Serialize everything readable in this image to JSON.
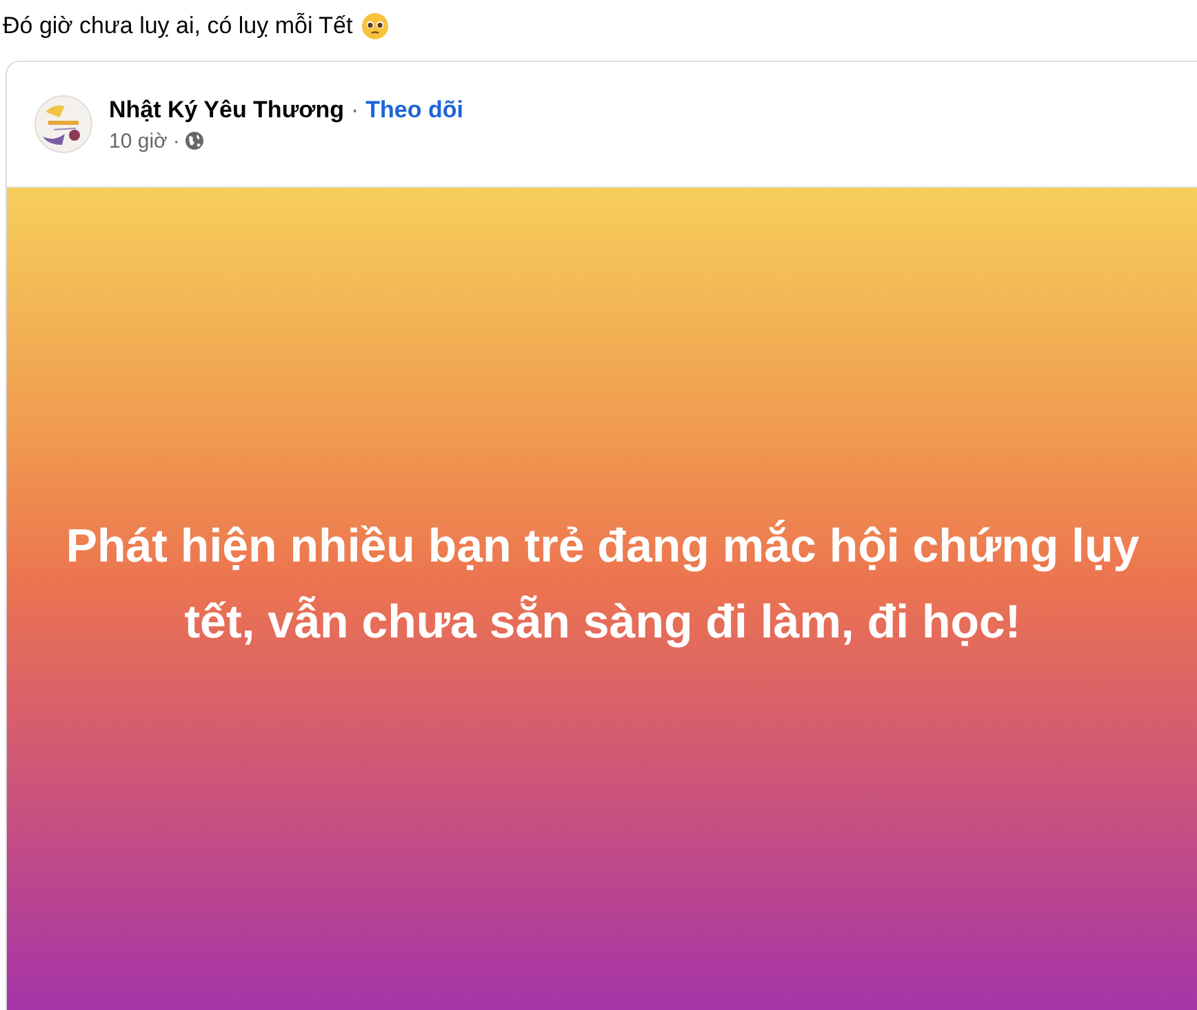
{
  "caption": "Đó giờ chưa luỵ ai, có luỵ mỗi Tết",
  "post": {
    "page_name": "Nhật Ký Yêu Thương",
    "separator": "·",
    "follow": "Theo dõi",
    "time": "10 giờ",
    "time_separator": "·",
    "status_text": "Phát hiện nhiều bạn trẻ đang mắc hội chứng lụy tết, vẫn chưa sẵn sàng đi làm, đi học!"
  }
}
